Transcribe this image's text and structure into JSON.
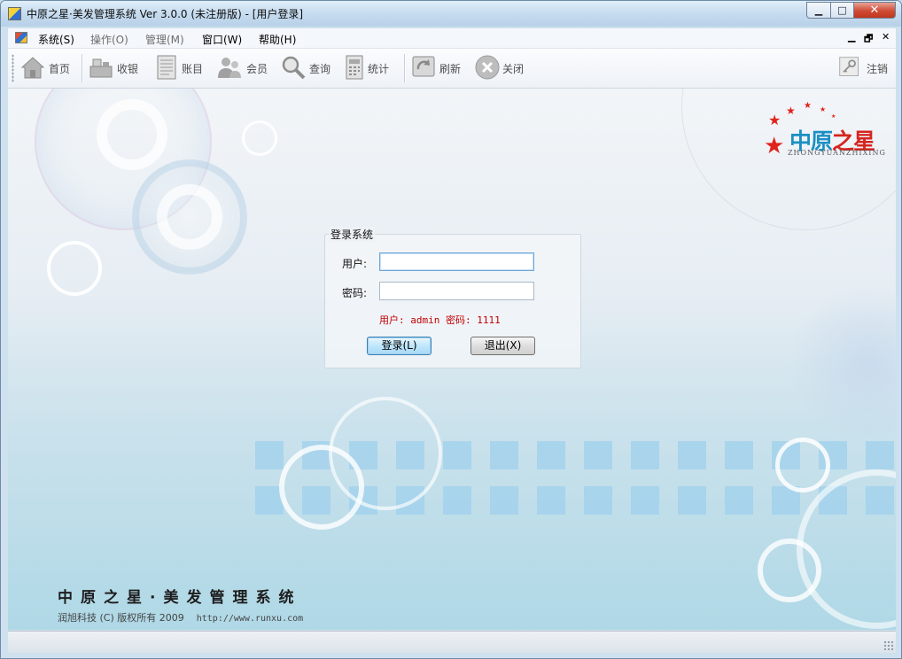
{
  "window": {
    "title": "中原之星·美发管理系统 Ver 3.0.0 (未注册版) - [用户登录]",
    "minimize_glyph": "▁",
    "maximize_glyph": "□",
    "close_glyph": "✕"
  },
  "menu": {
    "items": [
      {
        "label": "系统(S)",
        "enabled": true
      },
      {
        "label": "操作(O)",
        "enabled": false
      },
      {
        "label": "管理(M)",
        "enabled": false
      },
      {
        "label": "窗口(W)",
        "enabled": true
      },
      {
        "label": "帮助(H)",
        "enabled": true
      }
    ],
    "mdi_minimize": "▁",
    "mdi_restore": "🗗",
    "mdi_close": "✕"
  },
  "toolbar": {
    "buttons": [
      {
        "label": "首页",
        "icon": "home-icon"
      },
      {
        "label": "收银",
        "icon": "cashier-icon"
      },
      {
        "label": "账目",
        "icon": "ledger-icon"
      },
      {
        "label": "会员",
        "icon": "members-icon"
      },
      {
        "label": "查询",
        "icon": "search-icon"
      },
      {
        "label": "统计",
        "icon": "statistics-icon"
      },
      {
        "label": "刷新",
        "icon": "refresh-icon"
      },
      {
        "label": "关闭",
        "icon": "close-icon"
      },
      {
        "label": "注销",
        "icon": "logout-key-icon"
      }
    ]
  },
  "logo": {
    "main": "中原",
    "accent": "之星",
    "sub": "ZHONGYUANZHIXING"
  },
  "login": {
    "legend": "登录系统",
    "user_label": "用户:",
    "user_value": "",
    "password_label": "密码:",
    "password_value": "",
    "hint": "用户: admin  密码: 1111",
    "login_button": "登录(L)",
    "exit_button": "退出(X)"
  },
  "footer": {
    "title": "中原之星·美发管理系统",
    "copyright": "润旭科技 (C) 版权所有 2009",
    "url": "http://www.runxu.com"
  },
  "colors": {
    "hint": "#c00000",
    "logo_blue": "#1c8fc4",
    "logo_red": "#d5251f"
  }
}
